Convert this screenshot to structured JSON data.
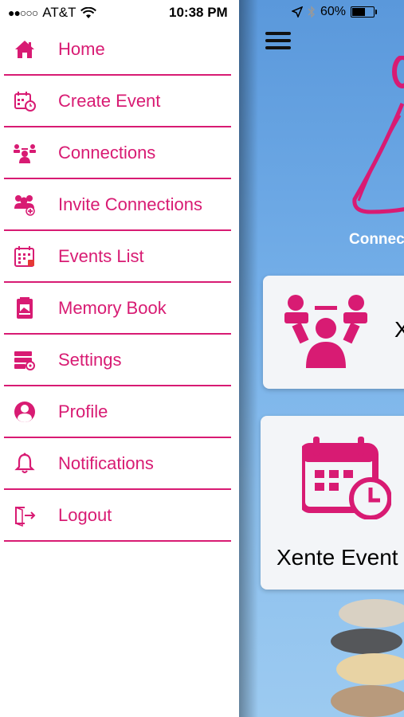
{
  "status_bar": {
    "signal": "●●○○○",
    "carrier": "AT&T",
    "time": "10:38 PM",
    "battery_percent": "60%",
    "battery_level": 0.6
  },
  "menu": {
    "items": [
      {
        "label": "Home",
        "icon": "home-icon"
      },
      {
        "label": "Create Event",
        "icon": "calendar-clock-icon"
      },
      {
        "label": "Connections",
        "icon": "connections-icon"
      },
      {
        "label": "Invite Connections",
        "icon": "invite-icon"
      },
      {
        "label": "Events List",
        "icon": "events-list-icon"
      },
      {
        "label": "Memory Book",
        "icon": "memory-book-icon"
      },
      {
        "label": "Settings",
        "icon": "settings-icon"
      },
      {
        "label": "Profile",
        "icon": "profile-icon"
      },
      {
        "label": "Notifications",
        "icon": "bell-icon"
      },
      {
        "label": "Logout",
        "icon": "logout-icon"
      }
    ]
  },
  "app": {
    "logo_text": "Connec",
    "card1_title": "X",
    "card2_title": "Xente Event"
  },
  "colors": {
    "accent": "#d81b73",
    "sky": "#6fa9e4"
  }
}
